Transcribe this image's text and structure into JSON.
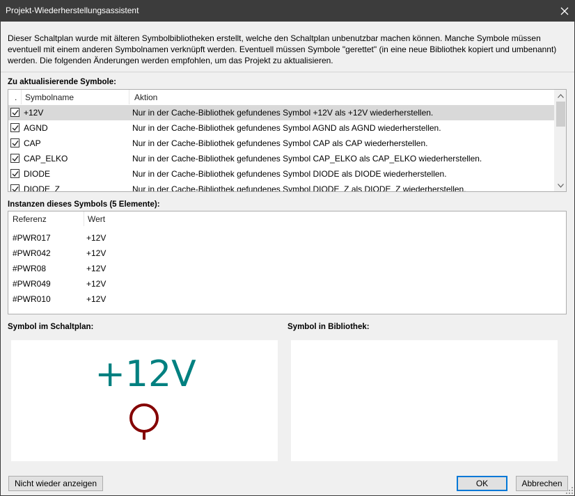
{
  "window": {
    "title": "Projekt-Wiederherstellungsassistent"
  },
  "intro_text": "Dieser Schaltplan wurde mit älteren Symbolbibliotheken erstellt, welche den Schaltplan unbenutzbar machen können. Manche Symbole müssen eventuell mit einem anderen Symbolnamen verknüpft werden. Eventuell müssen Symbole \"gerettet\" (in eine neue Bibliothek kopiert und umbenannt) werden. Die folgenden Änderungen werden empfohlen, um das Projekt zu aktualisieren.",
  "symbols_section": {
    "label": "Zu aktualisierende Symbole:",
    "columns": {
      "check": ".",
      "name": "Symbolname",
      "action": "Aktion"
    },
    "rows": [
      {
        "name": "+12V",
        "action": "Nur in der Cache-Bibliothek gefundenes Symbol +12V als +12V wiederherstellen.",
        "checked": true,
        "selected": true
      },
      {
        "name": "AGND",
        "action": "Nur in der Cache-Bibliothek gefundenes Symbol AGND als AGND wiederherstellen.",
        "checked": true,
        "selected": false
      },
      {
        "name": "CAP",
        "action": "Nur in der Cache-Bibliothek gefundenes Symbol CAP als CAP wiederherstellen.",
        "checked": true,
        "selected": false
      },
      {
        "name": "CAP_ELKO",
        "action": "Nur in der Cache-Bibliothek gefundenes Symbol CAP_ELKO als CAP_ELKO wiederherstellen.",
        "checked": true,
        "selected": false
      },
      {
        "name": "DIODE",
        "action": "Nur in der Cache-Bibliothek gefundenes Symbol DIODE als DIODE wiederherstellen.",
        "checked": true,
        "selected": false
      },
      {
        "name": "DIODE_Z",
        "action": "Nur in der Cache-Bibliothek gefundenes Symbol DIODE_Z als DIODE_Z wiederherstellen.",
        "checked": true,
        "selected": false
      }
    ]
  },
  "instances_section": {
    "label": "Instanzen dieses Symbols (5 Elemente):",
    "columns": {
      "reference": "Referenz",
      "value": "Wert"
    },
    "rows": [
      {
        "reference": "#PWR017",
        "value": "+12V"
      },
      {
        "reference": "#PWR042",
        "value": "+12V"
      },
      {
        "reference": "#PWR08",
        "value": "+12V"
      },
      {
        "reference": "#PWR049",
        "value": "+12V"
      },
      {
        "reference": "#PWR010",
        "value": "+12V"
      }
    ]
  },
  "previews": {
    "schematic_label": "Symbol im Schaltplan:",
    "library_label": "Symbol in Bibliothek:",
    "schematic_symbol_text": "+12V",
    "text_color": "#008080",
    "symbol_color": "#840000"
  },
  "buttons": {
    "dont_show": "Nicht wieder anzeigen",
    "ok": "OK",
    "cancel": "Abbrechen"
  }
}
